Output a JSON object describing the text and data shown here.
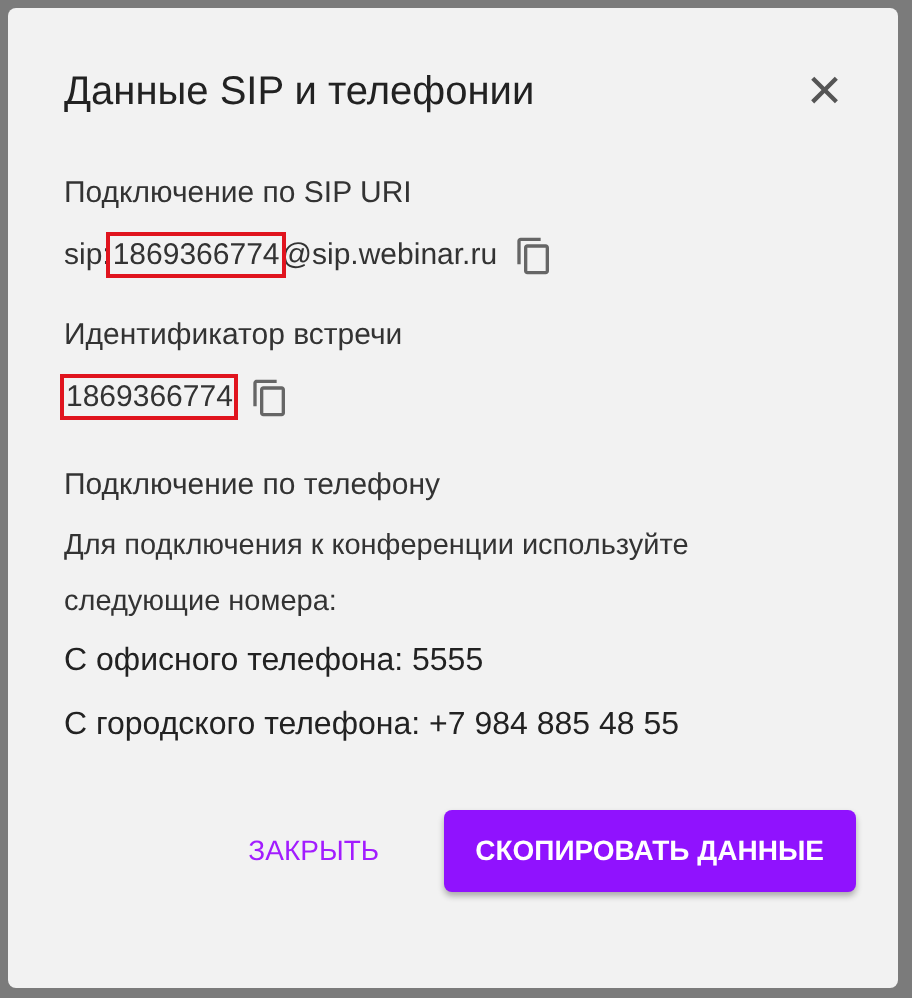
{
  "dialog": {
    "title": "Данные SIP и телефонии",
    "close_icon": "×",
    "sip_section": {
      "label": "Подключение по SIP URI",
      "uri_parts": [
        {
          "text": "sip:",
          "highlighted": false
        },
        {
          "text": "1869366774",
          "highlighted": true
        },
        {
          "text": "@sip.webinar.ru",
          "highlighted": false
        }
      ]
    },
    "meeting_section": {
      "label": "Идентификатор встречи",
      "id_parts": [
        {
          "text": "1869366774",
          "highlighted": true
        }
      ]
    },
    "phone_section": {
      "label": "Подключение по телефону",
      "description": "Для подключения к конференции используйте следующие номера:",
      "numbers": [
        "С офисного телефона: 5555",
        "С городского телефона: +7 984 885 48 55"
      ]
    },
    "buttons": [
      {
        "label": "ЗАКРЫТЬ",
        "kind": "text"
      },
      {
        "label": "СКОПИРОВАТЬ ДАННЫЕ",
        "kind": "primary"
      }
    ]
  }
}
